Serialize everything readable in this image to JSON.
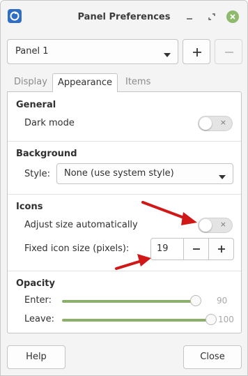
{
  "window": {
    "title": "Panel Preferences"
  },
  "panel_selector": {
    "value": "Panel 1"
  },
  "tabs": [
    {
      "label": "Display",
      "active": false
    },
    {
      "label": "Appearance",
      "active": true
    },
    {
      "label": "Items",
      "active": false
    }
  ],
  "general": {
    "title": "General",
    "dark_mode_label": "Dark mode",
    "dark_mode_on": false
  },
  "background": {
    "title": "Background",
    "style_label": "Style:",
    "style_value": "None (use system style)"
  },
  "icons": {
    "title": "Icons",
    "adjust_label": "Adjust size automatically",
    "adjust_on": false,
    "fixed_label": "Fixed icon size (pixels):",
    "fixed_value": "19"
  },
  "opacity": {
    "title": "Opacity",
    "enter_label": "Enter:",
    "enter_value": "90",
    "leave_label": "Leave:",
    "leave_value": "100"
  },
  "buttons": {
    "help": "Help",
    "close": "Close"
  },
  "toggle_off_glyph": "×",
  "colors": {
    "accent_green": "#8ab06a",
    "close_button": "#8fba6b",
    "annotation_arrow": "#d01818"
  }
}
